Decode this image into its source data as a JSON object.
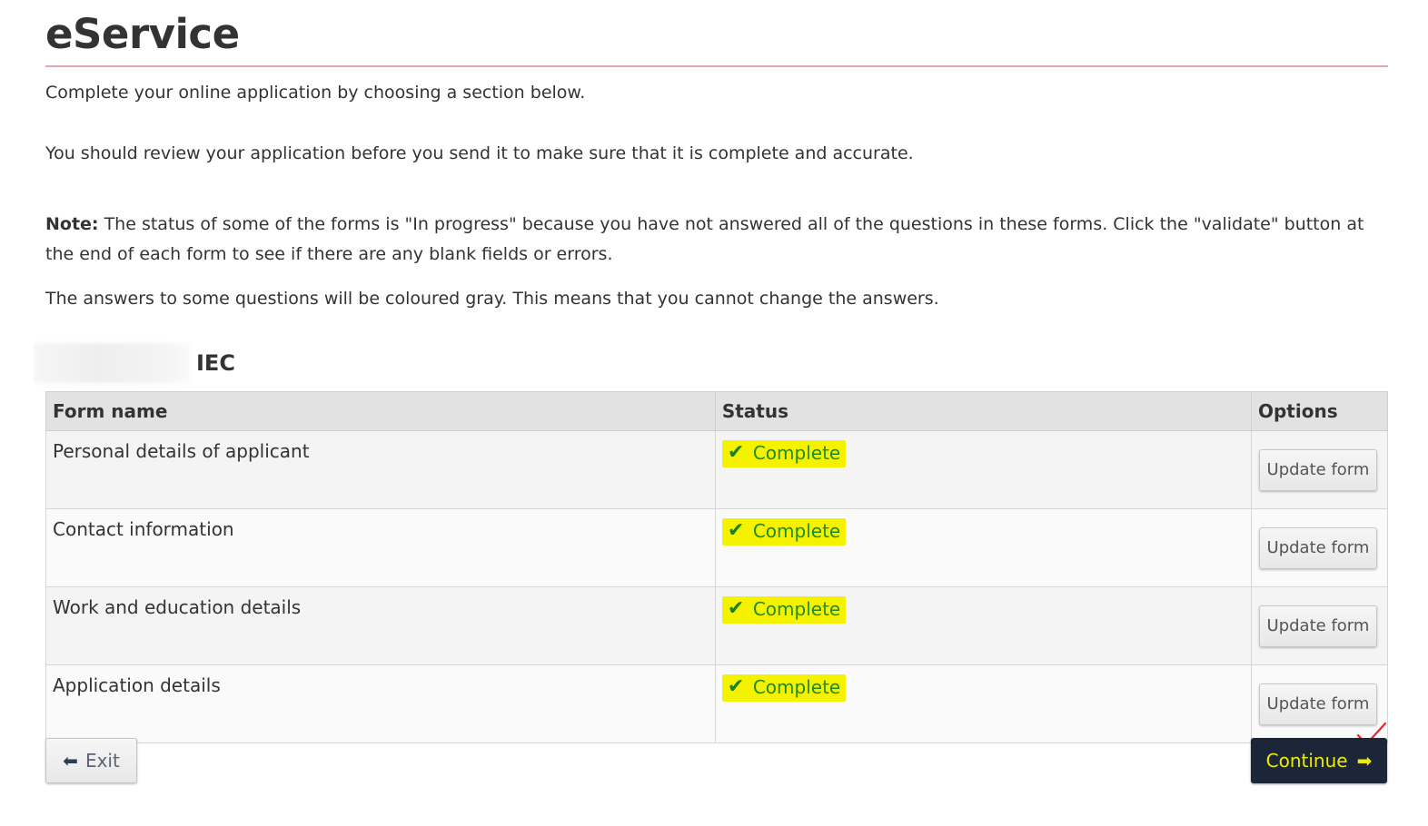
{
  "header": {
    "title": "eService"
  },
  "intro": {
    "line1": "Complete your online application by choosing a section below.",
    "line2": "You should review your application before you send it to make sure that it is complete and accurate.",
    "note_label": "Note:",
    "note_text": " The status of some of the forms is \"In progress\" because you have not answered all of the questions in these forms. Click the \"validate\" button at the end of each form to see if there are any blank fields or errors.",
    "line4": "The answers to some questions will be coloured gray. This means that you cannot change the answers."
  },
  "section": {
    "suffix": "IEC"
  },
  "table": {
    "headers": [
      "Form name",
      "Status",
      "Options"
    ],
    "rows": [
      {
        "name": "Personal details of applicant",
        "status": "Complete",
        "action": "Update form"
      },
      {
        "name": "Contact information",
        "status": "Complete",
        "action": "Update form"
      },
      {
        "name": "Work and education details",
        "status": "Complete",
        "action": "Update form"
      },
      {
        "name": "Application details",
        "status": "Complete",
        "action": "Update form"
      }
    ]
  },
  "footer": {
    "exit_label": "Exit",
    "continue_label": "Continue"
  },
  "icons": {
    "status": "check-icon",
    "exit": "arrow-left-icon",
    "continue": "arrow-right-icon"
  },
  "colors": {
    "title_rule": "#e0a7ad",
    "highlight": "#f5f200",
    "complete_text": "#1f8a1f",
    "continue_bg": "#1b2738",
    "continue_text": "#f0ea00"
  }
}
